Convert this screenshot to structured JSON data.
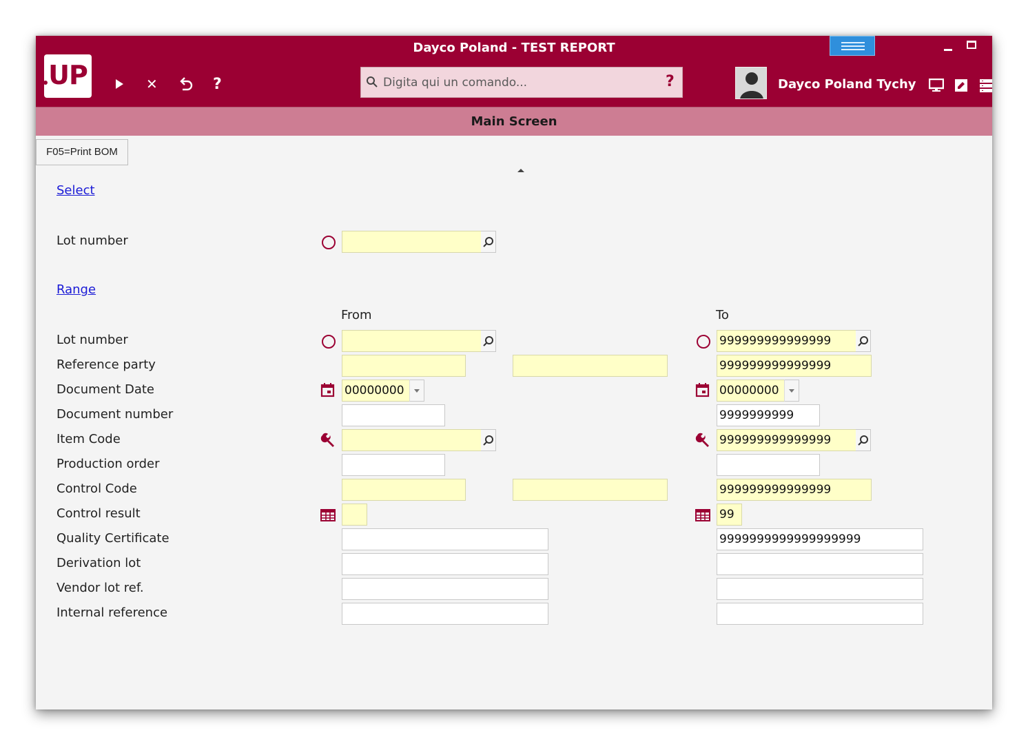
{
  "window": {
    "title": "Dayco Poland - TEST REPORT",
    "logo": "UP",
    "accent_color": "#9b0033"
  },
  "toolbar": {
    "run_icon": "play-icon",
    "close_label": "✕",
    "undo_label": "↶",
    "help_label": "?"
  },
  "command": {
    "placeholder": "Digita qui un comando...",
    "help_label": "?"
  },
  "user": {
    "name": "Dayco Poland Tychy"
  },
  "screen": {
    "title": "Main Screen",
    "f05_label": "F05=Print BOM"
  },
  "select_section": {
    "link": "Select",
    "lot_number_label": "Lot number",
    "lot_number_value": ""
  },
  "range_section": {
    "link": "Range",
    "from_label": "From",
    "to_label": "To",
    "rows": [
      {
        "label": "Lot number",
        "from": "",
        "to": "999999999999999"
      },
      {
        "label": "Reference party",
        "from": "",
        "from2": "",
        "to": "999999999999999"
      },
      {
        "label": "Document Date",
        "from": "00000000",
        "to": "00000000"
      },
      {
        "label": "Document number",
        "from": "",
        "to": "9999999999"
      },
      {
        "label": "Item Code",
        "from": "",
        "to": "999999999999999"
      },
      {
        "label": "Production order",
        "from": "",
        "to": ""
      },
      {
        "label": "Control Code",
        "from": "",
        "from2": "",
        "to": "999999999999999"
      },
      {
        "label": "Control result",
        "from": "",
        "to": "99"
      },
      {
        "label": "Quality Certificate",
        "from": "",
        "to": "9999999999999999999"
      },
      {
        "label": "Derivation lot",
        "from": "",
        "to": ""
      },
      {
        "label": "Vendor lot ref.",
        "from": "",
        "to": ""
      },
      {
        "label": "Internal reference",
        "from": "",
        "to": ""
      }
    ]
  }
}
